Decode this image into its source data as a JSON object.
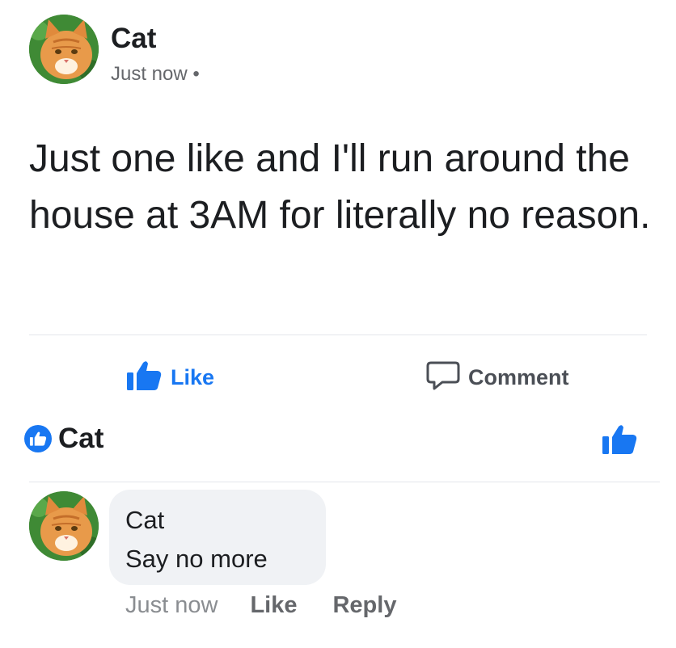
{
  "post": {
    "author": "Cat",
    "timestamp": "Just now",
    "privacy_dot": "•",
    "text": "Just one like and I'll run around the house at 3AM for literally no reason."
  },
  "actions": {
    "like_label": "Like",
    "comment_label": "Comment"
  },
  "likes": {
    "name": "Cat"
  },
  "comment": {
    "author": "Cat",
    "text": "Say no more",
    "timestamp": "Just now",
    "like_label": "Like",
    "reply_label": "Reply"
  },
  "colors": {
    "accent": "#1877f2",
    "bubble": "#f0f2f5",
    "meta": "#65676b"
  },
  "icons": {
    "avatar": "cat-avatar-icon",
    "like": "thumbs-up-icon",
    "comment": "speech-bubble-icon"
  }
}
